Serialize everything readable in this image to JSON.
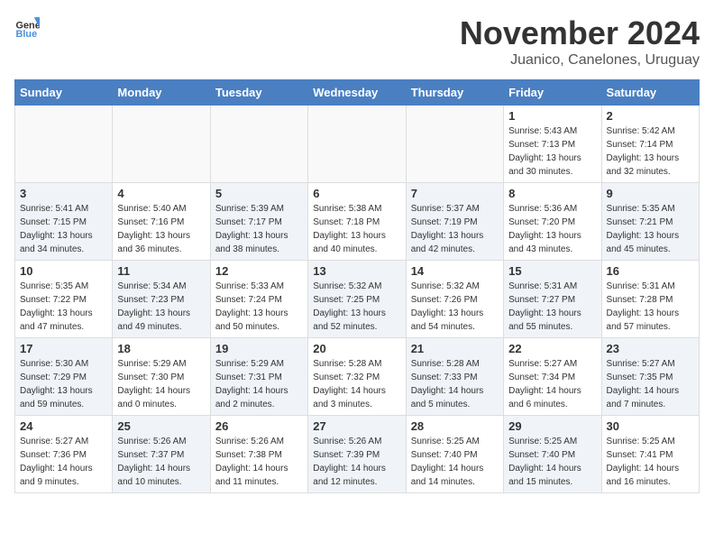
{
  "logo": {
    "general": "General",
    "blue": "Blue"
  },
  "title": "November 2024",
  "location": "Juanico, Canelones, Uruguay",
  "headers": [
    "Sunday",
    "Monday",
    "Tuesday",
    "Wednesday",
    "Thursday",
    "Friday",
    "Saturday"
  ],
  "rows": [
    [
      {
        "day": "",
        "empty": true
      },
      {
        "day": "",
        "empty": true
      },
      {
        "day": "",
        "empty": true
      },
      {
        "day": "",
        "empty": true
      },
      {
        "day": "",
        "empty": true
      },
      {
        "day": "1",
        "lines": [
          "Sunrise: 5:43 AM",
          "Sunset: 7:13 PM",
          "Daylight: 13 hours",
          "and 30 minutes."
        ]
      },
      {
        "day": "2",
        "lines": [
          "Sunrise: 5:42 AM",
          "Sunset: 7:14 PM",
          "Daylight: 13 hours",
          "and 32 minutes."
        ]
      }
    ],
    [
      {
        "day": "3",
        "shaded": true,
        "lines": [
          "Sunrise: 5:41 AM",
          "Sunset: 7:15 PM",
          "Daylight: 13 hours",
          "and 34 minutes."
        ]
      },
      {
        "day": "4",
        "lines": [
          "Sunrise: 5:40 AM",
          "Sunset: 7:16 PM",
          "Daylight: 13 hours",
          "and 36 minutes."
        ]
      },
      {
        "day": "5",
        "shaded": true,
        "lines": [
          "Sunrise: 5:39 AM",
          "Sunset: 7:17 PM",
          "Daylight: 13 hours",
          "and 38 minutes."
        ]
      },
      {
        "day": "6",
        "lines": [
          "Sunrise: 5:38 AM",
          "Sunset: 7:18 PM",
          "Daylight: 13 hours",
          "and 40 minutes."
        ]
      },
      {
        "day": "7",
        "shaded": true,
        "lines": [
          "Sunrise: 5:37 AM",
          "Sunset: 7:19 PM",
          "Daylight: 13 hours",
          "and 42 minutes."
        ]
      },
      {
        "day": "8",
        "lines": [
          "Sunrise: 5:36 AM",
          "Sunset: 7:20 PM",
          "Daylight: 13 hours",
          "and 43 minutes."
        ]
      },
      {
        "day": "9",
        "shaded": true,
        "lines": [
          "Sunrise: 5:35 AM",
          "Sunset: 7:21 PM",
          "Daylight: 13 hours",
          "and 45 minutes."
        ]
      }
    ],
    [
      {
        "day": "10",
        "lines": [
          "Sunrise: 5:35 AM",
          "Sunset: 7:22 PM",
          "Daylight: 13 hours",
          "and 47 minutes."
        ]
      },
      {
        "day": "11",
        "shaded": true,
        "lines": [
          "Sunrise: 5:34 AM",
          "Sunset: 7:23 PM",
          "Daylight: 13 hours",
          "and 49 minutes."
        ]
      },
      {
        "day": "12",
        "lines": [
          "Sunrise: 5:33 AM",
          "Sunset: 7:24 PM",
          "Daylight: 13 hours",
          "and 50 minutes."
        ]
      },
      {
        "day": "13",
        "shaded": true,
        "lines": [
          "Sunrise: 5:32 AM",
          "Sunset: 7:25 PM",
          "Daylight: 13 hours",
          "and 52 minutes."
        ]
      },
      {
        "day": "14",
        "lines": [
          "Sunrise: 5:32 AM",
          "Sunset: 7:26 PM",
          "Daylight: 13 hours",
          "and 54 minutes."
        ]
      },
      {
        "day": "15",
        "shaded": true,
        "lines": [
          "Sunrise: 5:31 AM",
          "Sunset: 7:27 PM",
          "Daylight: 13 hours",
          "and 55 minutes."
        ]
      },
      {
        "day": "16",
        "lines": [
          "Sunrise: 5:31 AM",
          "Sunset: 7:28 PM",
          "Daylight: 13 hours",
          "and 57 minutes."
        ]
      }
    ],
    [
      {
        "day": "17",
        "shaded": true,
        "lines": [
          "Sunrise: 5:30 AM",
          "Sunset: 7:29 PM",
          "Daylight: 13 hours",
          "and 59 minutes."
        ]
      },
      {
        "day": "18",
        "lines": [
          "Sunrise: 5:29 AM",
          "Sunset: 7:30 PM",
          "Daylight: 14 hours",
          "and 0 minutes."
        ]
      },
      {
        "day": "19",
        "shaded": true,
        "lines": [
          "Sunrise: 5:29 AM",
          "Sunset: 7:31 PM",
          "Daylight: 14 hours",
          "and 2 minutes."
        ]
      },
      {
        "day": "20",
        "lines": [
          "Sunrise: 5:28 AM",
          "Sunset: 7:32 PM",
          "Daylight: 14 hours",
          "and 3 minutes."
        ]
      },
      {
        "day": "21",
        "shaded": true,
        "lines": [
          "Sunrise: 5:28 AM",
          "Sunset: 7:33 PM",
          "Daylight: 14 hours",
          "and 5 minutes."
        ]
      },
      {
        "day": "22",
        "lines": [
          "Sunrise: 5:27 AM",
          "Sunset: 7:34 PM",
          "Daylight: 14 hours",
          "and 6 minutes."
        ]
      },
      {
        "day": "23",
        "shaded": true,
        "lines": [
          "Sunrise: 5:27 AM",
          "Sunset: 7:35 PM",
          "Daylight: 14 hours",
          "and 7 minutes."
        ]
      }
    ],
    [
      {
        "day": "24",
        "lines": [
          "Sunrise: 5:27 AM",
          "Sunset: 7:36 PM",
          "Daylight: 14 hours",
          "and 9 minutes."
        ]
      },
      {
        "day": "25",
        "shaded": true,
        "lines": [
          "Sunrise: 5:26 AM",
          "Sunset: 7:37 PM",
          "Daylight: 14 hours",
          "and 10 minutes."
        ]
      },
      {
        "day": "26",
        "lines": [
          "Sunrise: 5:26 AM",
          "Sunset: 7:38 PM",
          "Daylight: 14 hours",
          "and 11 minutes."
        ]
      },
      {
        "day": "27",
        "shaded": true,
        "lines": [
          "Sunrise: 5:26 AM",
          "Sunset: 7:39 PM",
          "Daylight: 14 hours",
          "and 12 minutes."
        ]
      },
      {
        "day": "28",
        "lines": [
          "Sunrise: 5:25 AM",
          "Sunset: 7:40 PM",
          "Daylight: 14 hours",
          "and 14 minutes."
        ]
      },
      {
        "day": "29",
        "shaded": true,
        "lines": [
          "Sunrise: 5:25 AM",
          "Sunset: 7:40 PM",
          "Daylight: 14 hours",
          "and 15 minutes."
        ]
      },
      {
        "day": "30",
        "lines": [
          "Sunrise: 5:25 AM",
          "Sunset: 7:41 PM",
          "Daylight: 14 hours",
          "and 16 minutes."
        ]
      }
    ]
  ]
}
